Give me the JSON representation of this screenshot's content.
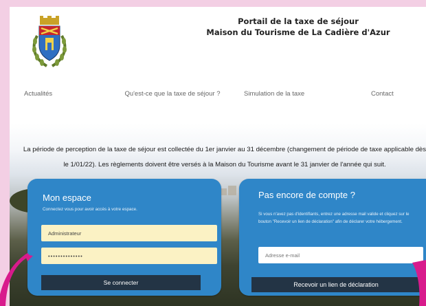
{
  "header": {
    "title_line1": "Portail de la taxe de séjour",
    "title_line2": "Maison du Tourisme de La Cadière d'Azur"
  },
  "nav": {
    "items": [
      {
        "label": "Actualités"
      },
      {
        "label": "Qu'est-ce que la taxe de séjour ?"
      },
      {
        "label": "Simulation de la taxe"
      },
      {
        "label": "Contact"
      }
    ]
  },
  "notice": {
    "text": "La période de perception de la taxe de séjour est collectée du 1er janvier au 31 décembre (changement de période de taxe applicable dès le 1/01/22). Les règlements doivent être versés à la Maison du Tourisme avant le 31 janvier de l'année qui suit."
  },
  "login": {
    "title": "Mon espace",
    "subtitle": "Connectez vous pour avoir accès à votre espace.",
    "username_value": "Administrateur",
    "password_value": "••••••••••••••",
    "submit_label": "Se connecter"
  },
  "signup": {
    "title": "Pas encore de compte ?",
    "text": "Si vous n'avez pas d'identifiants, entrez une adresse mail valide et cliquez sur le bouton \"Recevoir un lien de déclaration\" afin de déclarer votre hébergement.",
    "email_placeholder": "Adresse e-mail",
    "submit_label": "Recevoir un lien de déclaration"
  },
  "colors": {
    "background": "#f3cfe4",
    "card_blue": "#2f86c8",
    "button_dark": "#233445",
    "input_yellow": "#fbf2c4",
    "ribbon_magenta": "#d81b8c"
  },
  "icons": {
    "logo": "coat-of-arms-icon"
  }
}
